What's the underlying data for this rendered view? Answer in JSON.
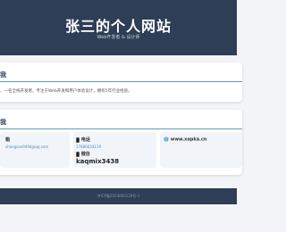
{
  "hero": {
    "title": "张三的个人网站",
    "subtitle": "Web开发者 & 设计师"
  },
  "about": {
    "heading": "我",
    "text": "，一名全栈开发者，专注于Web开发和用户体验设计，拥有5年行业经验。"
  },
  "contact": {
    "heading": "我",
    "email_label": "箱",
    "email_value": "zhangsan9494@qq.com",
    "phone_label": "电话",
    "phone_value": "17880633119",
    "wechat_label": "微信",
    "wechat_value": "kaqmix3438",
    "website_value": "www.xapka.cn"
  },
  "footer": {
    "text": "京ICP备2024000129号-1"
  },
  "colors": {
    "header_bg": "#2e3e56",
    "accent_rule": "#5f9bb8",
    "link": "#4a90c2"
  }
}
